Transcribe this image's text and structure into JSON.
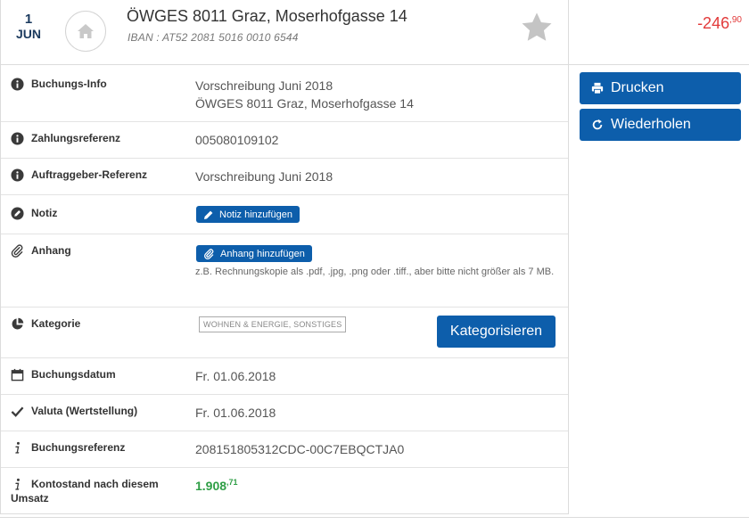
{
  "header": {
    "day": "1",
    "month": "JUN",
    "title": "ÖWGES 8011 Graz, Moserhofgasse 14",
    "iban": "IBAN : AT52 2081 5016 0010 6544",
    "amount_main": "-246",
    "amount_cents": ",90",
    "amount_color": "#e23a3a"
  },
  "actions": {
    "print_label": "Drucken",
    "repeat_label": "Wiederholen"
  },
  "details": {
    "buchungs_info": {
      "label": "Buchungs-Info",
      "line1": "Vorschreibung Juni 2018",
      "line2": "ÖWGES 8011 Graz, Moserhofgasse 14"
    },
    "zahlungsreferenz": {
      "label": "Zahlungsreferenz",
      "value": "005080109102"
    },
    "auftraggeber": {
      "label": "Auftraggeber-Referenz",
      "value": "Vorschreibung Juni 2018"
    },
    "notiz": {
      "label": "Notiz",
      "button": "Notiz hinzufügen"
    },
    "anhang": {
      "label": "Anhang",
      "button": "Anhang hinzufügen",
      "hint": "z.B. Rechnungskopie als .pdf, .jpg, .png oder .tiff., aber bitte nicht größer als 7 MB."
    },
    "kategorie": {
      "label": "Kategorie",
      "tag": "WOHNEN & ENERGIE, SONSTIGES",
      "button": "Kategorisieren"
    },
    "buchungsdatum": {
      "label": "Buchungsdatum",
      "value": "Fr. 01.06.2018"
    },
    "valuta": {
      "label": "Valuta (Wertstellung)",
      "value": "Fr. 01.06.2018"
    },
    "buchungsreferenz": {
      "label": "Buchungsreferenz",
      "value": "208151805312CDC-00C7EBQCTJA0"
    },
    "kontostand": {
      "label_line1": "Kontostand nach diesem",
      "label_line2": "Umsatz",
      "value_main": "1.908",
      "value_cents": ",71",
      "value_color": "#2e9e45"
    }
  },
  "colors": {
    "primary": "#0d5eab"
  }
}
